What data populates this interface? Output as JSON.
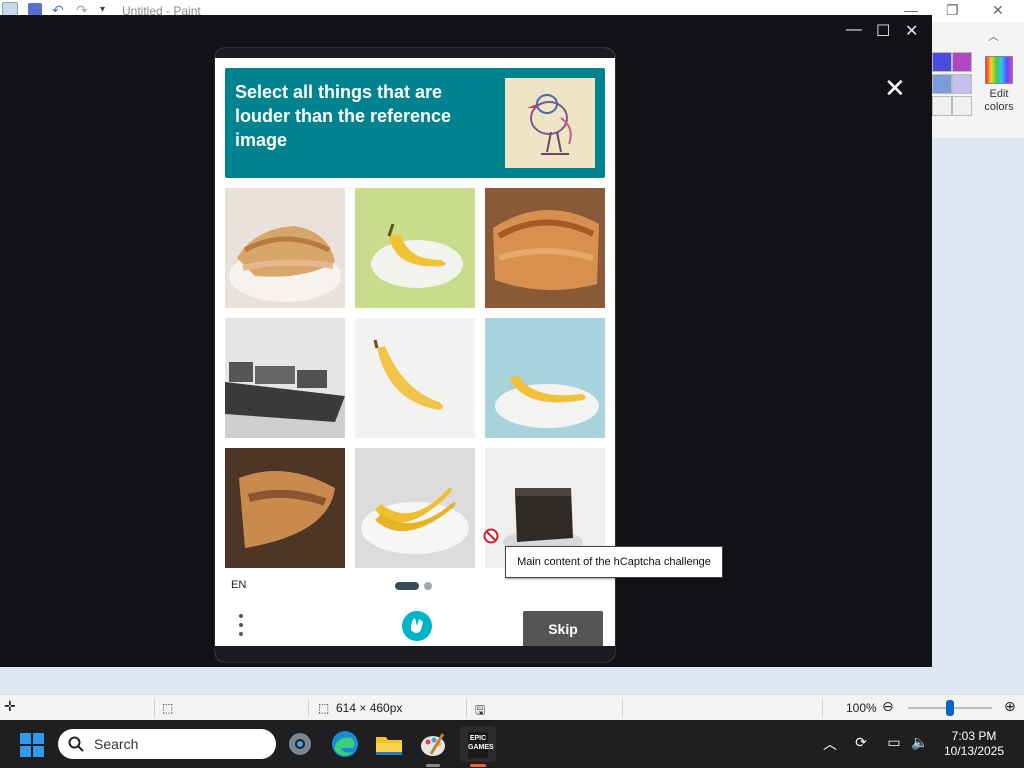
{
  "paint": {
    "window_title": "Untitled - Paint",
    "edit_colors_label": "Edit colors",
    "palette_colors": [
      "#4b4be0",
      "#b048c0",
      "#7a9cd8",
      "#c8c0ec",
      "#f0f0f0",
      "#f0f0f0"
    ]
  },
  "captcha": {
    "prompt_text": "Select all things that are louder than the reference image",
    "reference_image_icon": "bird-sketch-image",
    "tiles": [
      {
        "subject": "pie-slice"
      },
      {
        "subject": "banana-on-plate"
      },
      {
        "subject": "pie-slice"
      },
      {
        "subject": "cargo-ship"
      },
      {
        "subject": "banana"
      },
      {
        "subject": "banana-on-plate"
      },
      {
        "subject": "pie-slice"
      },
      {
        "subject": "bananas-on-plate"
      },
      {
        "subject": "cake-slice"
      }
    ],
    "language": "EN",
    "page_indicator": {
      "current": 1,
      "total": 2
    },
    "skip_label": "Skip",
    "tooltip_text": "Main content of the hCaptcha challenge",
    "accent_color": "#00838f"
  },
  "statusbar": {
    "canvas_size": "614 × 460px",
    "zoom_level": "100%"
  },
  "taskbar": {
    "search_label": "Search",
    "apps": [
      "settings-icon",
      "edge-icon",
      "file-explorer-icon",
      "paint-icon",
      "epic-games-icon"
    ],
    "epic_label": "EPIC GAMES",
    "time": "7:03 PM",
    "date": "10/13/2025"
  }
}
